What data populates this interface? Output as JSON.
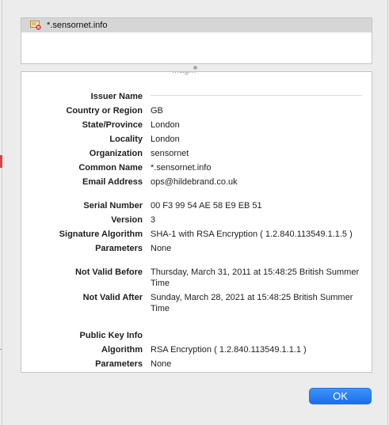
{
  "certificate_list": {
    "items": [
      {
        "name": "*.sensornet.info",
        "icon": "certificate-invalid-icon"
      }
    ]
  },
  "details": {
    "issuer_header": "Issuer Name",
    "issuer": [
      {
        "label": "Country or Region",
        "value": "GB"
      },
      {
        "label": "State/Province",
        "value": "London"
      },
      {
        "label": "Locality",
        "value": "London"
      },
      {
        "label": "Organization",
        "value": "sensornet"
      },
      {
        "label": "Common Name",
        "value": "*.sensornet.info"
      },
      {
        "label": "Email Address",
        "value": "ops@hildebrand.co.uk"
      }
    ],
    "serial": [
      {
        "label": "Serial Number",
        "value": "00 F3 99 54 AE 58 E9 EB 51"
      },
      {
        "label": "Version",
        "value": "3"
      },
      {
        "label": "Signature Algorithm",
        "value": "SHA-1 with RSA Encryption ( 1.2.840.113549.1.1.5 )"
      },
      {
        "label": "Parameters",
        "value": "None"
      }
    ],
    "validity": [
      {
        "label": "Not Valid Before",
        "value": "Thursday, March 31, 2011 at 15:48:25 British Summer Time"
      },
      {
        "label": "Not Valid After",
        "value": "Sunday, March 28, 2021 at 15:48:25 British Summer Time"
      }
    ],
    "public_key_header": "Public Key Info",
    "public_key": [
      {
        "label": "Algorithm",
        "value": "RSA Encryption ( 1.2.840.113549.1.1.1 )"
      },
      {
        "label": "Parameters",
        "value": "None"
      }
    ]
  },
  "buttons": {
    "ok_label": "OK"
  },
  "colors": {
    "accent": "#1a6ff0",
    "selection": "#d6d6d6",
    "invalid": "#d63a3a"
  }
}
